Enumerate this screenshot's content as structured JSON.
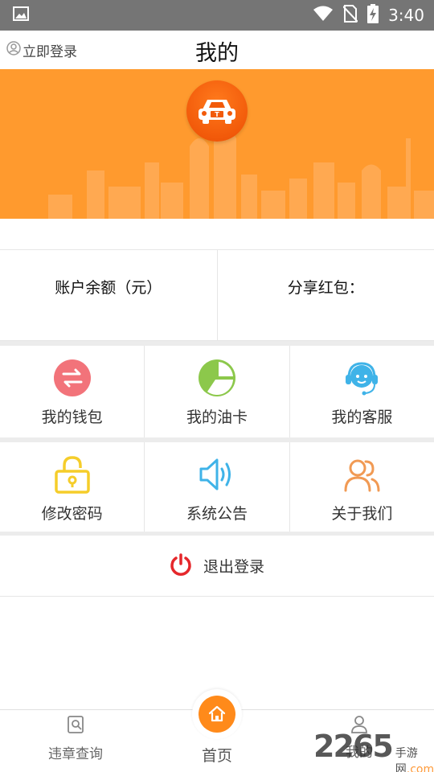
{
  "status_bar": {
    "time": "3:40"
  },
  "header": {
    "login_label": "立即登录",
    "title": "我的"
  },
  "balance": {
    "account_label": "账户余额（元）",
    "share_label": "分享红包："
  },
  "menu": {
    "wallet": "我的钱包",
    "oil_card": "我的油卡",
    "service": "我的客服",
    "change_password": "修改密码",
    "announcement": "系统公告",
    "about": "关于我们"
  },
  "logout_label": "退出登录",
  "tabs": {
    "query": "违章查询",
    "home": "首页",
    "mine": "我的"
  },
  "watermark": {
    "number": "2265",
    "site": "手游网",
    "domain": ".com"
  },
  "colors": {
    "banner": "#ff9a2e",
    "accent": "#ff8a1a",
    "wallet_icon": "#f2737a",
    "oil_icon": "#8cc84b",
    "service_icon": "#3fb3e8",
    "password_icon": "#f5cd2a",
    "announcement_icon": "#3fb3e8",
    "about_icon": "#f19a54",
    "logout_icon": "#e5272b"
  }
}
